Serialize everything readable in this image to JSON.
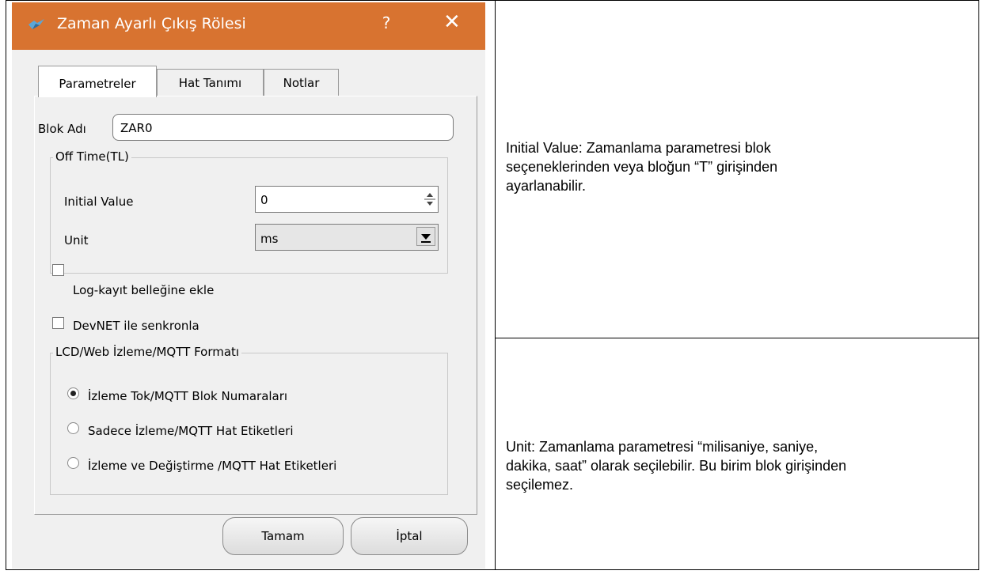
{
  "dialog": {
    "title": "Zaman Ayarlı Çıkış Rölesi",
    "help_label": "?",
    "close_label": "✕",
    "tabs": [
      {
        "label": "Parametreler",
        "active": true
      },
      {
        "label": "Hat Tanımı",
        "active": false
      },
      {
        "label": "Notlar",
        "active": false
      }
    ],
    "block_name_label": "Blok Adı",
    "block_name_value": "ZAR0",
    "off_time": {
      "legend": "Off Time(TL)",
      "initial_value_label": "Initial Value",
      "initial_value": "0",
      "unit_label": "Unit",
      "unit_value": "ms"
    },
    "checkboxes": [
      {
        "label": "Log-kayıt belleğine ekle",
        "checked": false
      },
      {
        "label": "DevNET ile senkronla",
        "checked": false
      }
    ],
    "format": {
      "legend": "LCD/Web İzleme/MQTT Formatı",
      "options": [
        {
          "label": "İzleme Tok/MQTT Blok Numaraları",
          "selected": true
        },
        {
          "label": "Sadece İzleme/MQTT Hat Etiketleri",
          "selected": false
        },
        {
          "label": "İzleme ve Değiştirme /MQTT Hat Etiketleri",
          "selected": false
        }
      ]
    },
    "ok_label": "Tamam",
    "cancel_label": "İptal",
    "colors": {
      "titlebar": "#d87330",
      "window_bg": "#f0f0f0"
    }
  },
  "notes": {
    "initial_value_line1": "Initial Value:  Zamanlama parametresi blok",
    "initial_value_line2": "seçeneklerinden veya bloğun “T” girişinden",
    "initial_value_line3": "ayarlanabilir.",
    "unit_line1": "Unit:  Zamanlama parametresi “milisaniye, saniye,",
    "unit_line2": "dakika, saat” olarak seçilebilir. Bu birim blok girişinden",
    "unit_line3": "seçilemez."
  }
}
